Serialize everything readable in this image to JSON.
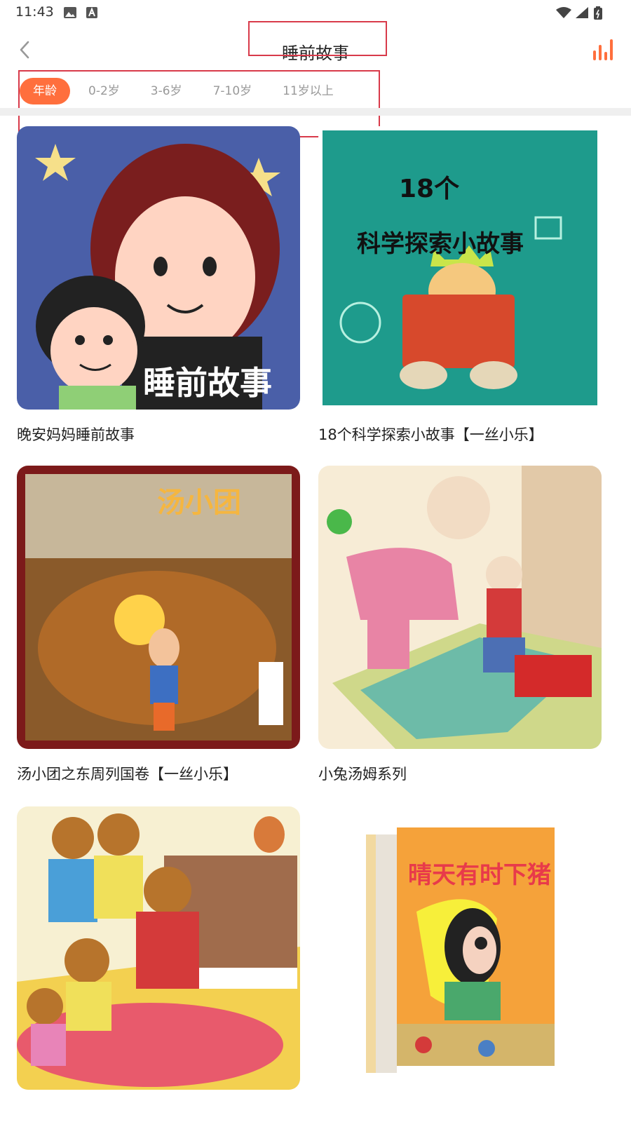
{
  "status": {
    "time": "11:43"
  },
  "header": {
    "title": "睡前故事",
    "back_icon": "chevron-left-icon",
    "right_icon": "bar-chart-icon",
    "accent": "#ff6f3d"
  },
  "filters": {
    "items": [
      "年龄",
      "0-2岁",
      "3-6岁",
      "7-10岁",
      "11岁以上"
    ],
    "active_index": 0
  },
  "books": [
    {
      "title": "晚安妈妈睡前故事",
      "cover_text": "睡前故事"
    },
    {
      "title": "18个科学探索小故事【一丝小乐】",
      "cover_text_1": "18个",
      "cover_text_2": "科学探索小故事"
    },
    {
      "title": "汤小团之东周列国卷【一丝小乐】",
      "cover_text": "汤小团"
    },
    {
      "title": "小兔汤姆系列"
    },
    {
      "title": ""
    },
    {
      "title": "",
      "cover_text": "晴天有时下猪"
    }
  ]
}
